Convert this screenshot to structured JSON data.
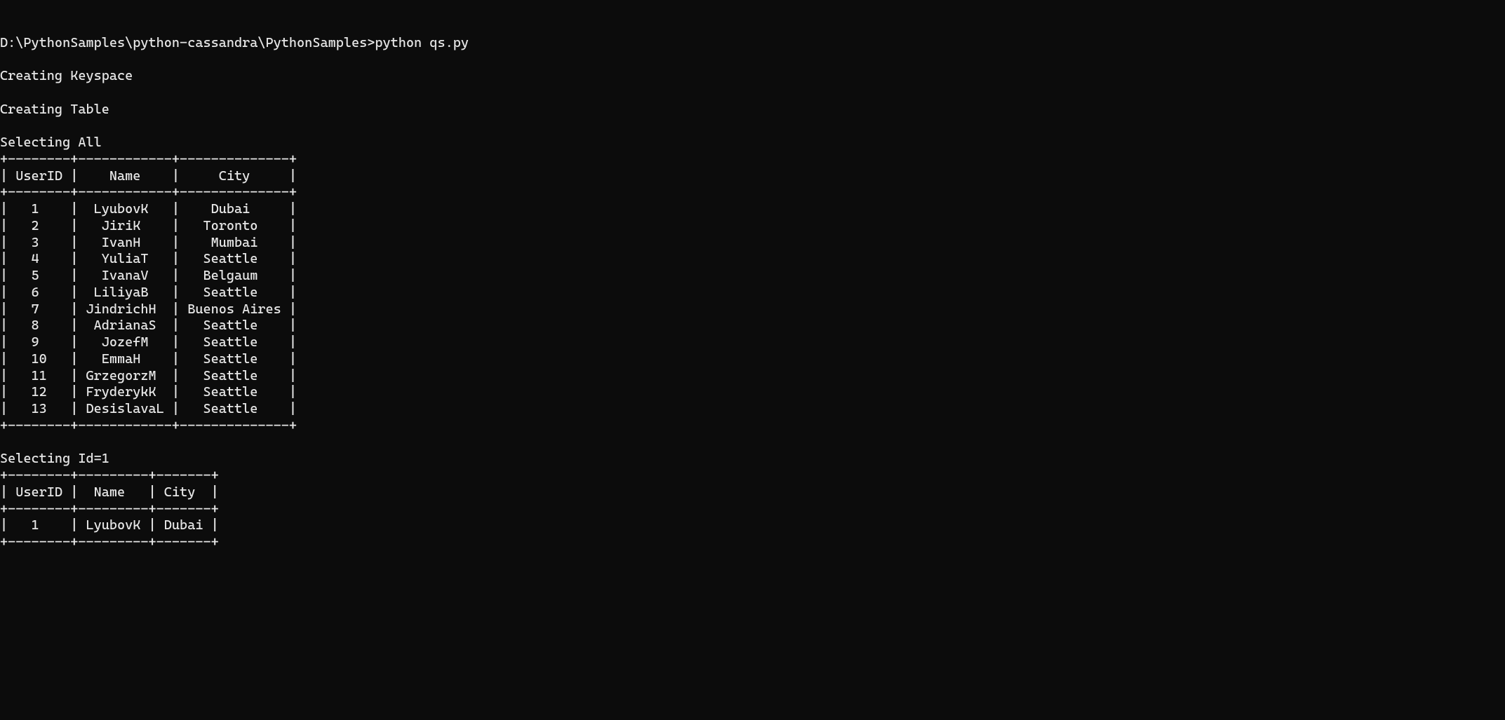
{
  "prompt": "D:\\PythonSamples\\python-cassandra\\PythonSamples>python qs.py",
  "msg_keyspace": "Creating Keyspace",
  "msg_table": "Creating Table",
  "msg_select_all": "Selecting All",
  "msg_select_id1": "Selecting Id=1",
  "table_all": {
    "columns": [
      "UserID",
      "Name",
      "City"
    ],
    "widths": [
      8,
      12,
      14
    ],
    "rows": [
      [
        "1",
        "LyubovK",
        "Dubai"
      ],
      [
        "2",
        "JiriK",
        "Toronto"
      ],
      [
        "3",
        "IvanH",
        "Mumbai"
      ],
      [
        "4",
        "YuliaT",
        "Seattle"
      ],
      [
        "5",
        "IvanaV",
        "Belgaum"
      ],
      [
        "6",
        "LiliyaB",
        "Seattle"
      ],
      [
        "7",
        "JindrichH",
        "Buenos Aires"
      ],
      [
        "8",
        "AdrianaS",
        "Seattle"
      ],
      [
        "9",
        "JozefM",
        "Seattle"
      ],
      [
        "10",
        "EmmaH",
        "Seattle"
      ],
      [
        "11",
        "GrzegorzM",
        "Seattle"
      ],
      [
        "12",
        "FryderykK",
        "Seattle"
      ],
      [
        "13",
        "DesislavaL",
        "Seattle"
      ]
    ]
  },
  "table_id1": {
    "columns": [
      "UserID",
      "Name",
      "City"
    ],
    "widths": [
      8,
      9,
      7
    ],
    "rows": [
      [
        "1",
        "LyubovK",
        "Dubai"
      ]
    ]
  }
}
